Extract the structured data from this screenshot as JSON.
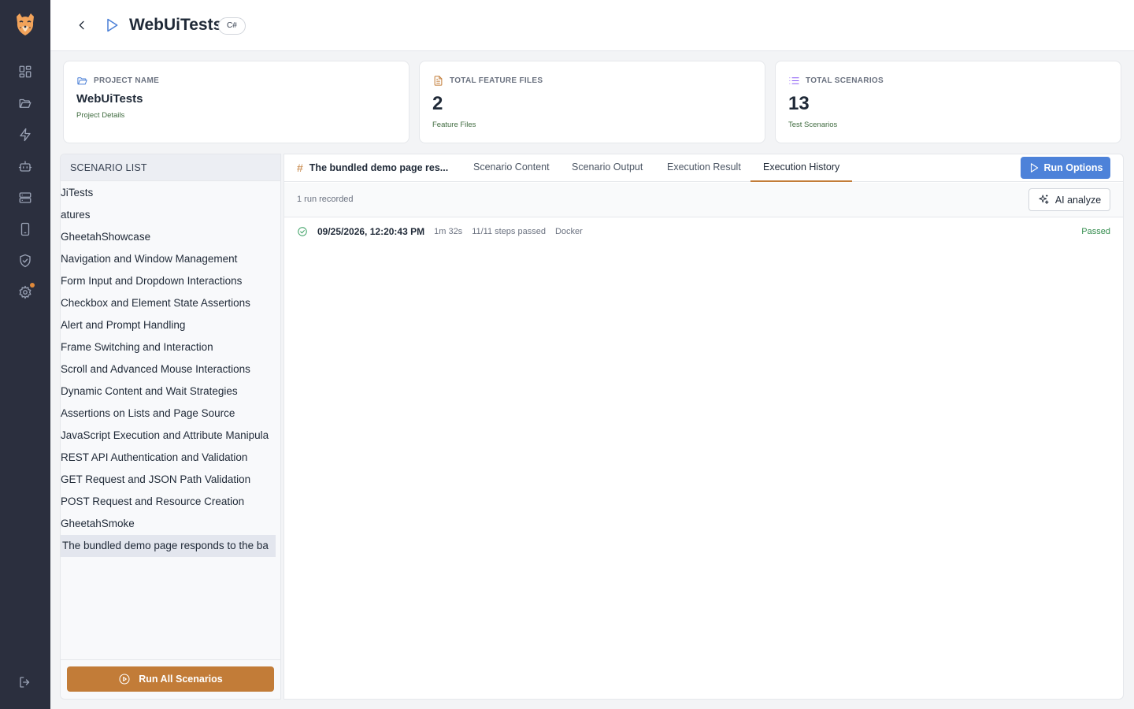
{
  "sidebar": {
    "logo": "cheetah-logo-icon",
    "items": [
      {
        "icon": "dashboard-icon"
      },
      {
        "icon": "folder-icon"
      },
      {
        "icon": "lightning-icon"
      },
      {
        "icon": "robot-icon"
      },
      {
        "icon": "server-icon"
      },
      {
        "icon": "mobile-icon"
      },
      {
        "icon": "shield-icon"
      },
      {
        "icon": "settings-icon",
        "has_notification": true
      }
    ],
    "logout_icon": "logout-icon"
  },
  "header": {
    "title": "WebUiTests",
    "language_badge": "C#"
  },
  "cards": {
    "project": {
      "label": "PROJECT NAME",
      "value": "WebUiTests",
      "sub": "Project Details"
    },
    "features": {
      "label": "TOTAL FEATURE FILES",
      "value": "2",
      "sub": "Feature Files"
    },
    "scenarios": {
      "label": "TOTAL SCENARIOS",
      "value": "13",
      "sub": "Test Scenarios"
    }
  },
  "scenario_panel": {
    "header": "SCENARIO LIST",
    "items": [
      "JiTests",
      "atures",
      "GheetahShowcase",
      "Navigation and Window Management",
      "Form Input and Dropdown Interactions",
      "Checkbox and Element State Assertions",
      "Alert and Prompt Handling",
      "Frame Switching and Interaction",
      "Scroll and Advanced Mouse Interactions",
      "Dynamic Content and Wait Strategies",
      "Assertions on Lists and Page Source",
      "JavaScript Execution and Attribute Manipula",
      "REST API Authentication and Validation",
      "GET Request and JSON Path Validation",
      "POST Request and Resource Creation",
      "GheetahSmoke",
      "The bundled demo page responds to the ba"
    ],
    "active_index": 16,
    "run_all_label": "Run All Scenarios"
  },
  "main": {
    "scenario_title": "The bundled demo page res...",
    "tabs": [
      "Scenario Content",
      "Scenario Output",
      "Execution Result",
      "Execution History"
    ],
    "active_tab": 3,
    "run_options_label": "Run Options",
    "run_count": "1 run recorded",
    "ai_analyze_label": "AI analyze",
    "history": [
      {
        "date": "09/25/2026, 12:20:43 PM",
        "duration": "1m 32s",
        "steps": "11/11 steps passed",
        "environment": "Docker",
        "status": "Passed"
      }
    ]
  },
  "colors": {
    "accent_orange": "#c27c38",
    "accent_blue": "#4d82d9",
    "sidebar_bg": "#2b2f3e",
    "success_green": "#2f8a4a"
  }
}
